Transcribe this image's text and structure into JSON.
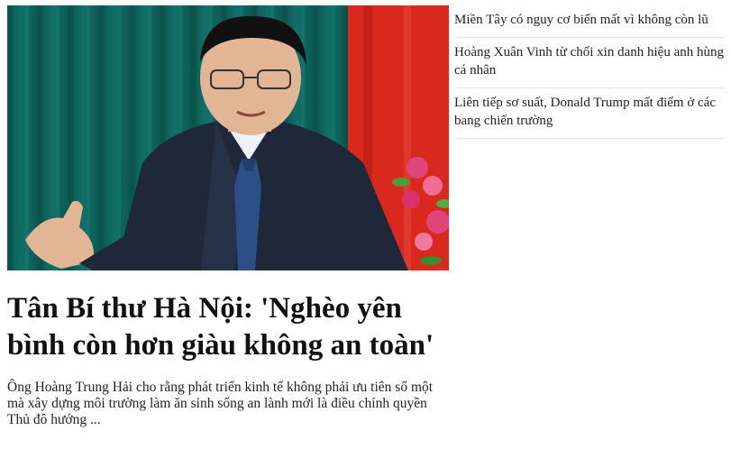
{
  "lead": {
    "image_alt": "",
    "headline": "Tân Bí thư Hà Nội: 'Nghèo yên bình còn hơn giàu không an toàn'",
    "summary": "Ông Hoàng Trung Hải cho rằng phát triển kinh tế không phải ưu tiên số một mà xây dựng môi trường làm ăn sinh sống an lành mới là điều chính quyền Thủ đô hướng ..."
  },
  "sidebar": {
    "items": [
      {
        "title": "Miền Tây có nguy cơ biến mất vì không còn lũ"
      },
      {
        "title": "Hoàng Xuân Vinh từ chối xin danh hiệu anh hùng cá nhân"
      },
      {
        "title": "Liên tiếp sơ suất, Donald Trump mất điểm ở các bang chiến trường"
      }
    ]
  },
  "colors": {
    "curtain_teal": "#0f6a63",
    "flag_red": "#d9281e",
    "suit_navy": "#1e2838",
    "tie_blue": "#2b4f86",
    "flower_pink": "#e0457a"
  }
}
